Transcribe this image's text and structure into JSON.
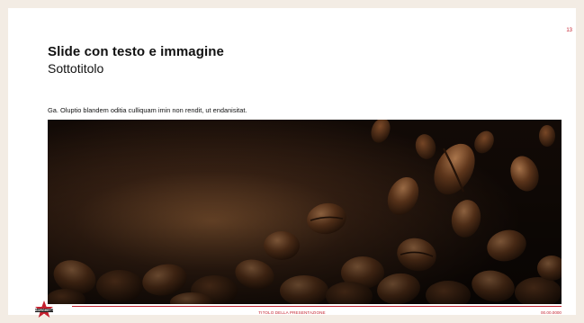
{
  "slide": {
    "page_number": "13",
    "title": "Slide con testo e immagine",
    "subtitle": "Sottotitolo",
    "body": "Ga. Oluptio blandem oditia culliquam imin non rendit, ut endanisitat.",
    "image": {
      "subject": "coffee-beans-photo"
    }
  },
  "footer": {
    "presentation_title": "TITOLO DELLA PRESENTAZIONE",
    "date": "00.00.0000",
    "logo_text": "BORGHETTI"
  },
  "colors": {
    "accent": "#c4212f",
    "page_background": "#f3ece4",
    "slide_background": "#ffffff",
    "text": "#111111"
  }
}
